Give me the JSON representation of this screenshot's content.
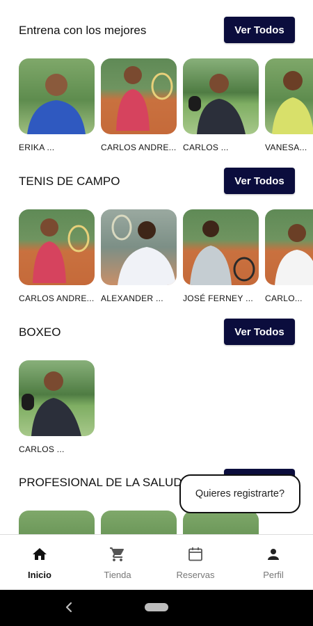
{
  "sections": [
    {
      "title": "Entrena con los mejores",
      "button": "Ver Todos",
      "trainers": [
        {
          "name": "ERIKA ...",
          "photo": "trainer-photo"
        },
        {
          "name": "CARLOS ANDRE...",
          "photo": "trainer-photo"
        },
        {
          "name": "CARLOS ...",
          "photo": "trainer-photo"
        },
        {
          "name": "VANESA...",
          "photo": "trainer-photo"
        }
      ]
    },
    {
      "title": "TENIS DE CAMPO",
      "button": "Ver Todos",
      "trainers": [
        {
          "name": "CARLOS ANDRE...",
          "photo": "trainer-photo"
        },
        {
          "name": "ALEXANDER ...",
          "photo": "trainer-photo"
        },
        {
          "name": "JOSÉ FERNEY ...",
          "photo": "trainer-photo"
        },
        {
          "name": "CARLO...",
          "photo": "trainer-photo"
        }
      ]
    },
    {
      "title": "BOXEO",
      "button": "Ver Todos",
      "trainers": [
        {
          "name": "CARLOS ...",
          "photo": "trainer-photo"
        }
      ]
    },
    {
      "title": "PROFESIONAL DE LA SALUD",
      "button": "Ver Todos",
      "trainers": [
        {
          "name": "",
          "photo": "trainer-photo"
        },
        {
          "name": "",
          "photo": "trainer-photo"
        },
        {
          "name": "",
          "photo": "trainer-photo"
        }
      ]
    }
  ],
  "toast": {
    "text": "Quieres registrarte?"
  },
  "bottom_nav": {
    "items": [
      {
        "label": "Inicio",
        "icon": "home-icon",
        "active": true
      },
      {
        "label": "Tienda",
        "icon": "cart-icon",
        "active": false
      },
      {
        "label": "Reservas",
        "icon": "calendar-icon",
        "active": false
      },
      {
        "label": "Perfil",
        "icon": "person-icon",
        "active": false
      }
    ]
  },
  "system_nav": {
    "back_icon": "back-icon",
    "home_icon": "home-pill"
  },
  "colors": {
    "accent": "#0b0d3d",
    "active_nav": "#111111",
    "inactive_nav": "#777777"
  }
}
